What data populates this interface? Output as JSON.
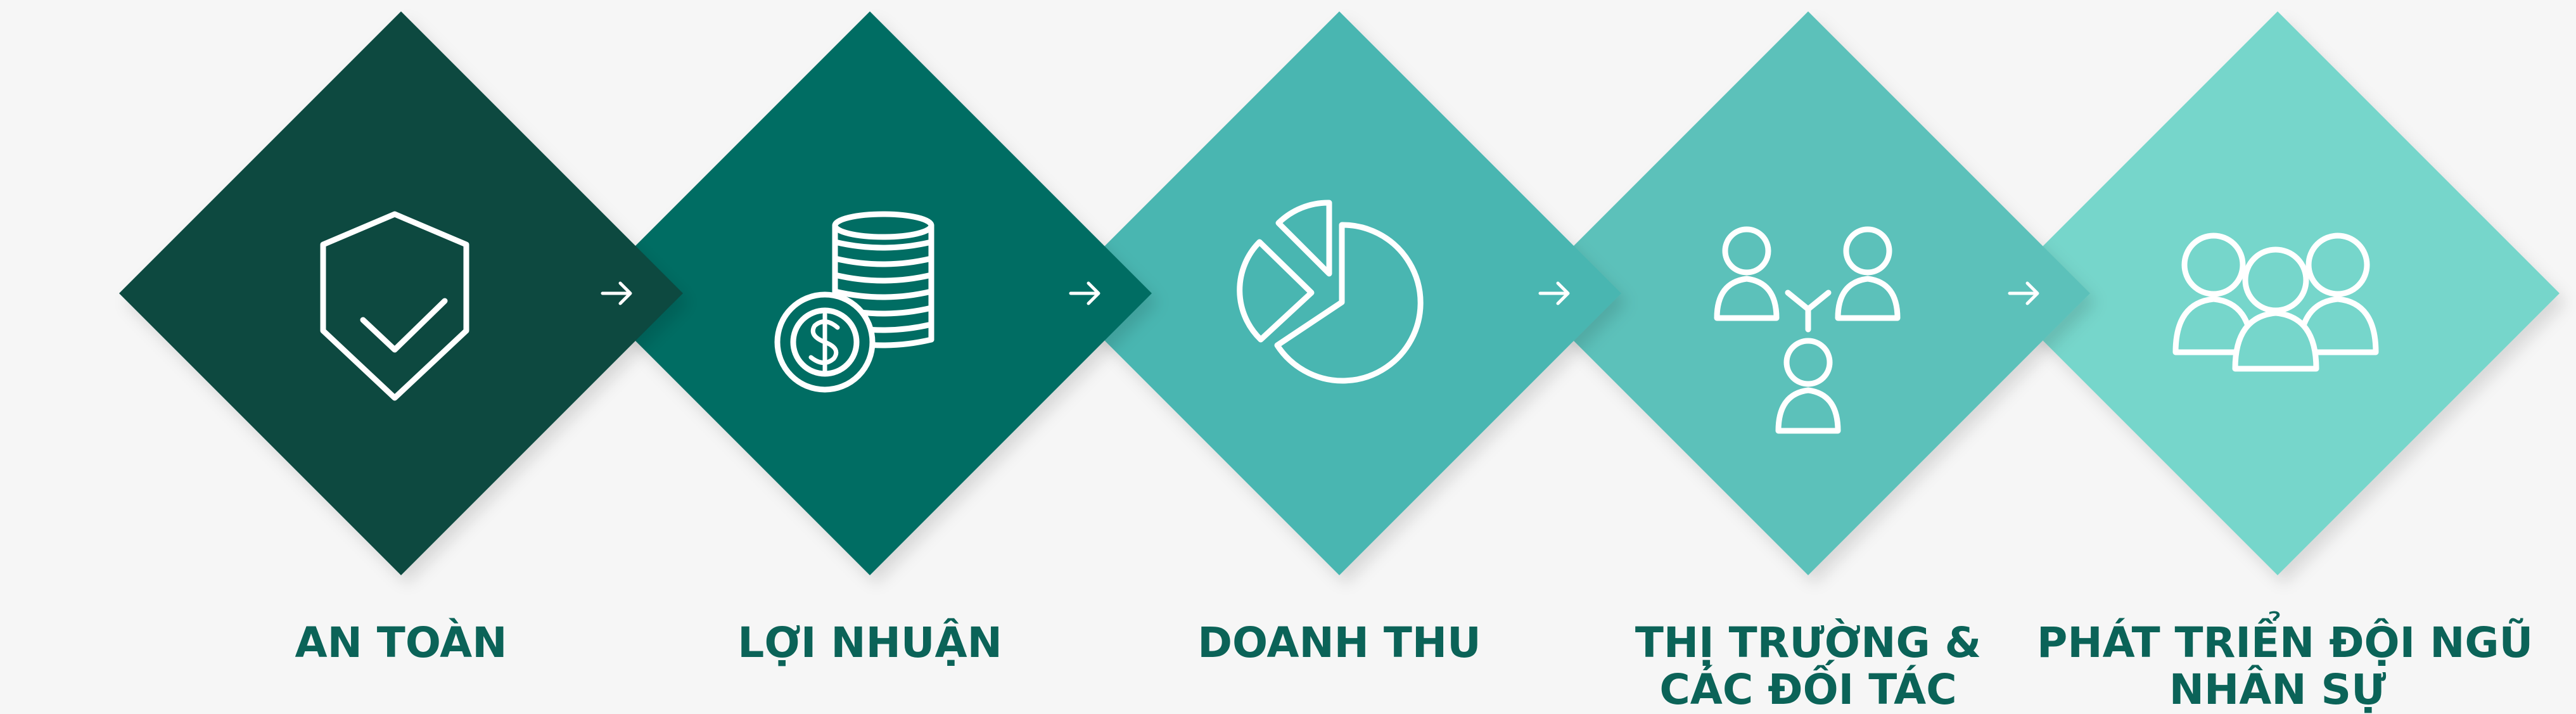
{
  "steps": [
    {
      "label_lines": [
        "AN TOÀN"
      ],
      "color": "#0c4a40",
      "icon": "shield-check-icon"
    },
    {
      "label_lines": [
        "LỢI NHUẬN"
      ],
      "color": "#006d63",
      "icon": "coins-dollar-icon"
    },
    {
      "label_lines": [
        "DOANH THU"
      ],
      "color": "#49b6b1",
      "icon": "pie-chart-icon"
    },
    {
      "label_lines": [
        "THỊ TRƯỜNG &",
        "CÁC ĐỐI TÁC"
      ],
      "color": "#5cc1ba",
      "icon": "partners-network-icon"
    },
    {
      "label_lines": [
        "PHÁT TRIỂN ĐỘI NGŨ",
        "NHÂN SỰ"
      ],
      "color": "#76d6cb",
      "icon": "team-group-icon"
    }
  ],
  "connector_icon": "arrow-right-icon",
  "label_color": "#0b6358"
}
